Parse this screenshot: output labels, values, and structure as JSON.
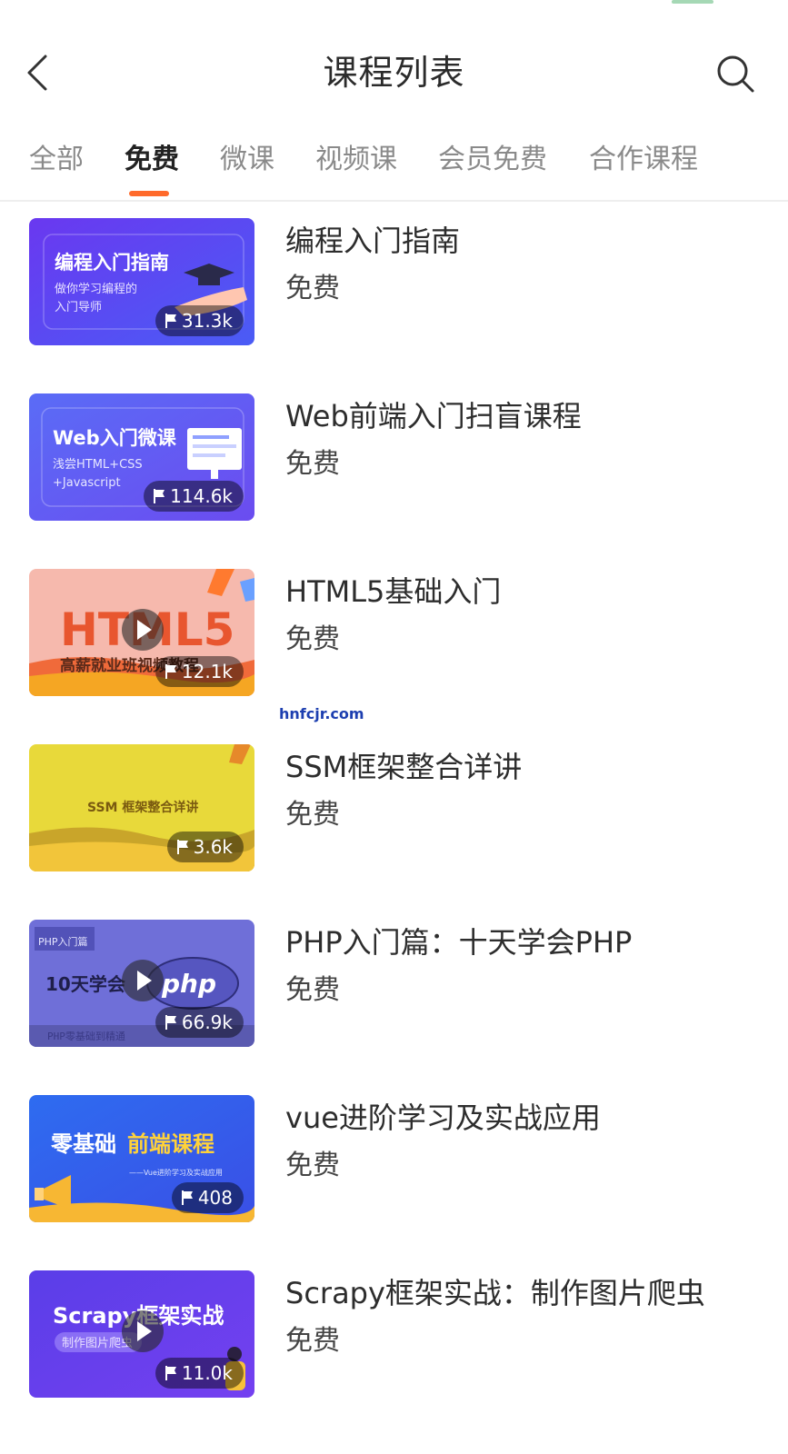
{
  "header": {
    "title": "课程列表",
    "back_icon": "chevron-left-icon",
    "search_icon": "search-icon"
  },
  "tabs": [
    {
      "label": "全部",
      "active": false
    },
    {
      "label": "免费",
      "active": true
    },
    {
      "label": "微课",
      "active": false
    },
    {
      "label": "视频课",
      "active": false
    },
    {
      "label": "会员免费",
      "active": false
    },
    {
      "label": "合作课程",
      "active": false
    }
  ],
  "accent_color": "#ff6a2b",
  "courses": [
    {
      "title": "编程入门指南",
      "price": "免费",
      "views": "31.3k",
      "thumb": {
        "heading": "编程入门指南",
        "line1": "做你学习编程的",
        "line2": "入门导师",
        "video": false
      }
    },
    {
      "title": "Web前端入门扫盲课程",
      "price": "免费",
      "views": "114.6k",
      "thumb": {
        "heading": "Web入门微课",
        "line1": "浅尝HTML+CSS",
        "line2": "+Javascript",
        "video": false
      }
    },
    {
      "title": "HTML5基础入门",
      "price": "免费",
      "views": "12.1k",
      "thumb": {
        "heading": "HTML5",
        "line1": "高薪就业班视频教程",
        "video": true
      }
    },
    {
      "title": "SSM框架整合详讲",
      "price": "免费",
      "views": "3.6k",
      "thumb": {
        "heading": "SSM 框架整合详讲",
        "video": false
      }
    },
    {
      "title": "PHP入门篇：十天学会PHP",
      "price": "免费",
      "views": "66.9k",
      "thumb": {
        "heading": "10天学会",
        "badge": "PHP入门篇",
        "logo": "php",
        "footer": "PHP零基础到精通",
        "video": true
      }
    },
    {
      "title": "vue进阶学习及实战应用",
      "price": "免费",
      "views": "408",
      "thumb": {
        "heading_a": "零基础",
        "heading_b": "前端课程",
        "line1": "——Vue进阶学习及实战应用",
        "video": false
      }
    },
    {
      "title": "Scrapy框架实战：制作图片爬虫",
      "price": "免费",
      "views": "11.0k",
      "thumb": {
        "heading": "Scrapy框架实战",
        "line1": "制作图片爬虫",
        "video": true
      }
    }
  ],
  "watermark": "hnfcjr.com"
}
